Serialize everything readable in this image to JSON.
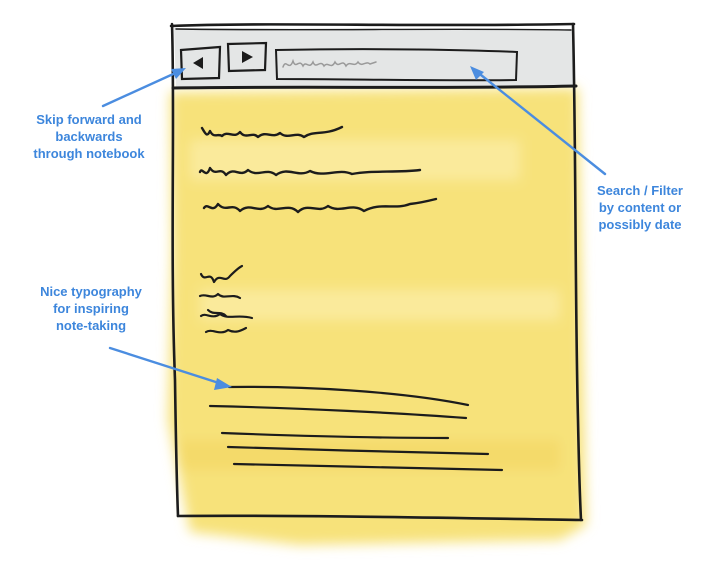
{
  "annotations": {
    "navigation": {
      "lines": [
        "Skip forward and",
        "backwards",
        "through notebook"
      ]
    },
    "search": {
      "lines": [
        "Search / Filter",
        "by content or",
        "possibly date"
      ]
    },
    "typography": {
      "lines": [
        "Nice typography",
        "for inspiring",
        "note-taking"
      ]
    }
  },
  "toolbar": {
    "back_icon": "triangle-left",
    "forward_icon": "triangle-right",
    "search_field": "scribbled placeholder"
  },
  "colors": {
    "paper": "#f7e27a",
    "paper_light": "#fbeeaa",
    "toolbar": "#e4e6e6",
    "ink": "#1c1c1c",
    "pencil": "#9a9a9a",
    "annotation": "#3d86dc"
  }
}
